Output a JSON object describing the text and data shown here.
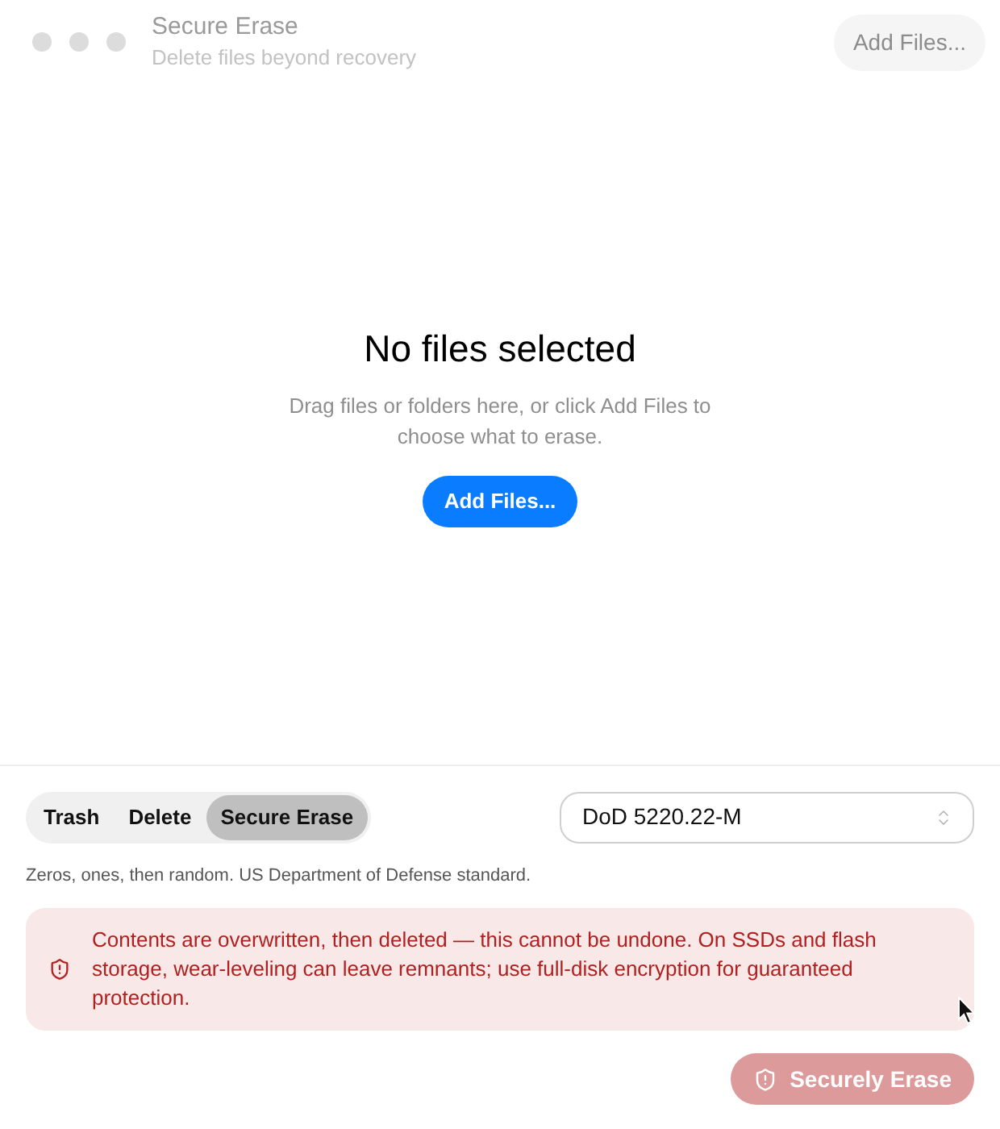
{
  "window": {
    "title": "Secure Erase",
    "subtitle": "Delete files beyond recovery",
    "active": false
  },
  "toolbar": {
    "add_button": {
      "label": "Add Files...",
      "disabled": true
    }
  },
  "empty_state": {
    "title": "No files selected",
    "message": "Drag files or folders here, or click Add Files to choose what to erase.",
    "button": "Add Files..."
  },
  "modes": [
    {
      "label": "Trash",
      "selected": false
    },
    {
      "label": "Delete",
      "selected": false
    },
    {
      "label": "Secure Erase",
      "selected": true
    }
  ],
  "method": {
    "value": "DoD 5220.22-M",
    "description": "Zeros, ones, then random. US Department of Defense standard."
  },
  "warning": {
    "text": "Contents are overwritten, then deleted — this cannot be undone. On SSDs and flash storage, wear-leveling can leave remnants; use full-disk encryption for guaranteed protection."
  },
  "erase_button": {
    "label": "Securely Erase",
    "disabled": true
  }
}
